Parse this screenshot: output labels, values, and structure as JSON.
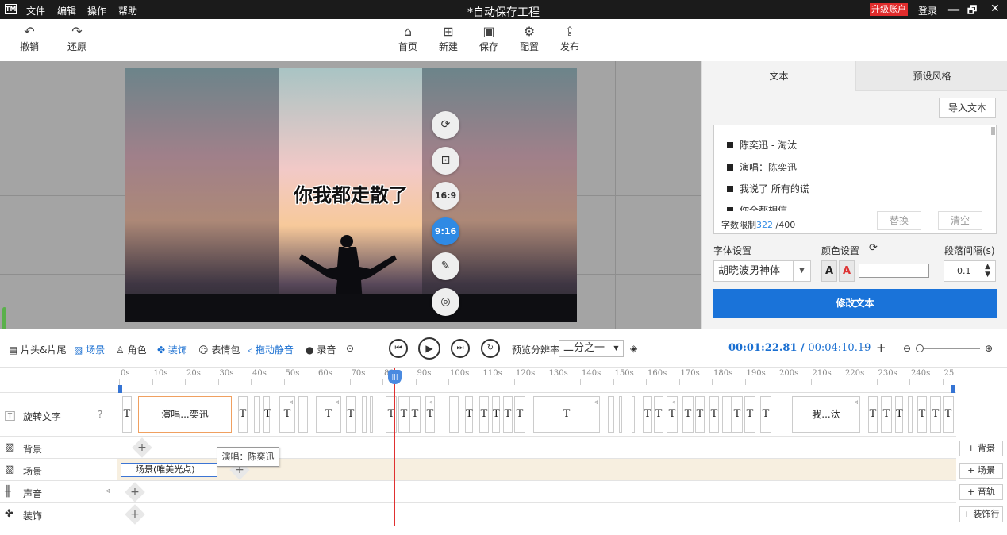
{
  "titlebar": {
    "logo": "TM",
    "menus": [
      "文件",
      "编辑",
      "操作",
      "帮助"
    ],
    "title": "*自动保存工程",
    "upgrade": "升级账户",
    "login": "登录",
    "controls": [
      "—",
      "🗗",
      "✕"
    ]
  },
  "toolbar": {
    "undo": "撤销",
    "redo": "还原",
    "home": "首页",
    "new": "新建",
    "save": "保存",
    "config": "配置",
    "publish": "发布"
  },
  "preview": {
    "lyric": "你我都走散了",
    "ratio_169": "16:9",
    "ratio_916": "9:16"
  },
  "panel": {
    "tab_text": "文本",
    "tab_style": "预设风格",
    "import": "导入文本",
    "lines": [
      "陈奕迅 - 淘汰",
      "演唱：陈奕迅",
      "我说了 所有的谎",
      "你全都相信"
    ],
    "limit_label": "字数限制",
    "limit_used": "322",
    "limit_max": "/400",
    "replace": "替换",
    "clear": "清空",
    "font_label": "字体设置",
    "color_label": "颜色设置",
    "interval_label": "段落间隔(s)",
    "font_value": "胡晓波男神体",
    "interval_value": "0.1",
    "modify": "修改文本"
  },
  "controls": {
    "head_tail": "片头&片尾",
    "scene": "场景",
    "role": "角色",
    "decor": "装饰",
    "emoji": "表情包",
    "drag_mute": "拖动静音",
    "record": "录音",
    "preview_res_label": "预览分辨率",
    "preview_res_value": "二分之一",
    "time_current": "00:01:22.81",
    "time_sep": " / ",
    "time_total": "00:04:10.19"
  },
  "timeline": {
    "ticks": [
      "0s",
      "10s",
      "20s",
      "30s",
      "40s",
      "50s",
      "60s",
      "70s",
      "80s",
      "90s",
      "100s",
      "110s",
      "120s",
      "130s",
      "140s",
      "150s",
      "160s",
      "170s",
      "180s",
      "190s",
      "200s",
      "210s",
      "220s",
      "230s",
      "240s",
      "25"
    ],
    "track_rotate": "旋转文字",
    "track_bg": "背景",
    "track_scene": "场景",
    "track_sound": "声音",
    "track_decor": "装饰",
    "clip_t": "T",
    "clip_singer": "演唱...奕迅",
    "clip_me": "我...汰",
    "scene_clip": "场景(唯美光点)",
    "tooltip": "演唱：陈奕迅",
    "add_bg": "+ 背景",
    "add_scene": "+ 场景",
    "add_track": "+ 音轨",
    "add_decor": "+ 装饰行",
    "plus": "+"
  }
}
